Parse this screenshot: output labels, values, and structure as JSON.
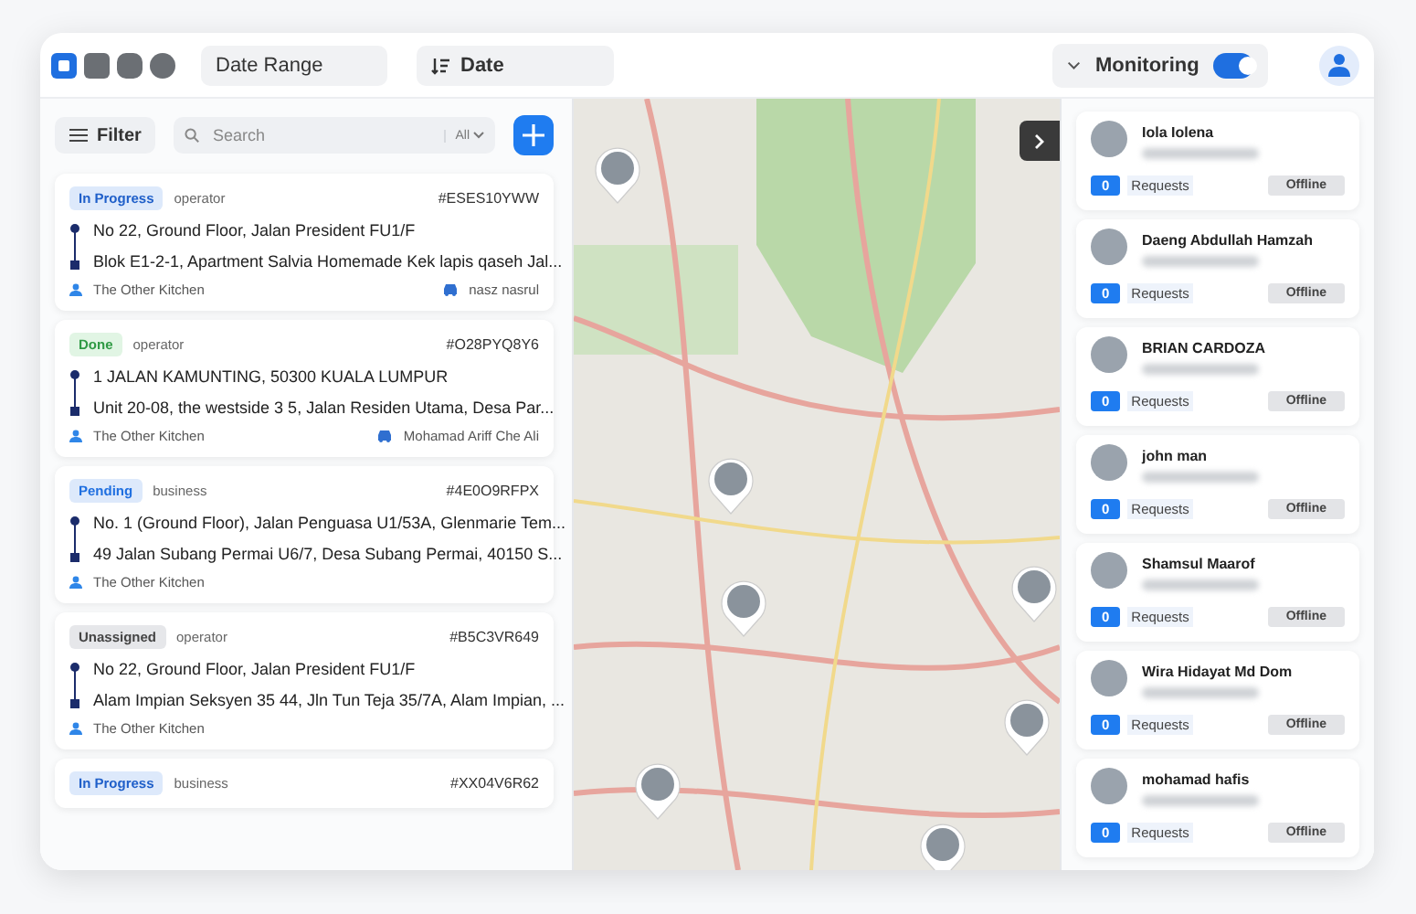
{
  "header": {
    "date_range": {
      "placeholder": "Date Range"
    },
    "sort": {
      "label": "Date"
    },
    "monitoring": {
      "label": "Monitoring",
      "on": true
    }
  },
  "orders_panel": {
    "filter_label": "Filter",
    "search": {
      "placeholder": "Search",
      "scope": "All"
    },
    "orders": [
      {
        "status": "In Progress",
        "kind": "in_progress",
        "type": "operator",
        "id": "#ESES10YWW",
        "pickup": "No 22, Ground Floor, Jalan President FU1/F",
        "dropoff": "Blok E1-2-1, Apartment Salvia Homemade Kek lapis qaseh Jal...",
        "merchant": "The Other Kitchen",
        "driver": "nasz nasrul"
      },
      {
        "status": "Done",
        "kind": "done",
        "type": "operator",
        "id": "#O28PYQ8Y6",
        "pickup": "1 JALAN KAMUNTING, 50300 KUALA LUMPUR",
        "dropoff": "Unit 20-08, the westside 3 5, Jalan Residen Utama, Desa Par...",
        "merchant": "The Other Kitchen",
        "driver": "Mohamad Ariff Che Ali"
      },
      {
        "status": "Pending",
        "kind": "pending",
        "type": "business",
        "id": "#4E0O9RFPX",
        "pickup": "No. 1 (Ground Floor), Jalan Penguasa U1/53A, Glenmarie Tem...",
        "dropoff": "49 Jalan Subang Permai U6/7, Desa Subang Permai, 40150 S...",
        "merchant": "The Other Kitchen"
      },
      {
        "status": "Unassigned",
        "kind": "unassigned",
        "type": "operator",
        "id": "#B5C3VR649",
        "pickup": "No 22, Ground Floor, Jalan President FU1/F",
        "dropoff": "Alam Impian Seksyen 35 44, Jln Tun Teja 35/7A, Alam Impian, ...",
        "merchant": "The Other Kitchen"
      },
      {
        "status": "In Progress",
        "kind": "in_progress",
        "type": "business",
        "id": "#XX04V6R62"
      }
    ]
  },
  "drivers": [
    {
      "name": "Iola Iolena",
      "requests": "0",
      "requests_label": "Requests",
      "status": "Offline"
    },
    {
      "name": "Daeng Abdullah Hamzah",
      "requests": "0",
      "requests_label": "Requests",
      "status": "Offline"
    },
    {
      "name": "BRIAN CARDOZA",
      "requests": "0",
      "requests_label": "Requests",
      "status": "Offline"
    },
    {
      "name": "john man",
      "requests": "0",
      "requests_label": "Requests",
      "status": "Offline"
    },
    {
      "name": "Shamsul Maarof",
      "requests": "0",
      "requests_label": "Requests",
      "status": "Offline"
    },
    {
      "name": "Wira Hidayat Md Dom",
      "requests": "0",
      "requests_label": "Requests",
      "status": "Offline"
    },
    {
      "name": "mohamad hafis",
      "requests": "0",
      "requests_label": "Requests",
      "status": "Offline"
    }
  ]
}
